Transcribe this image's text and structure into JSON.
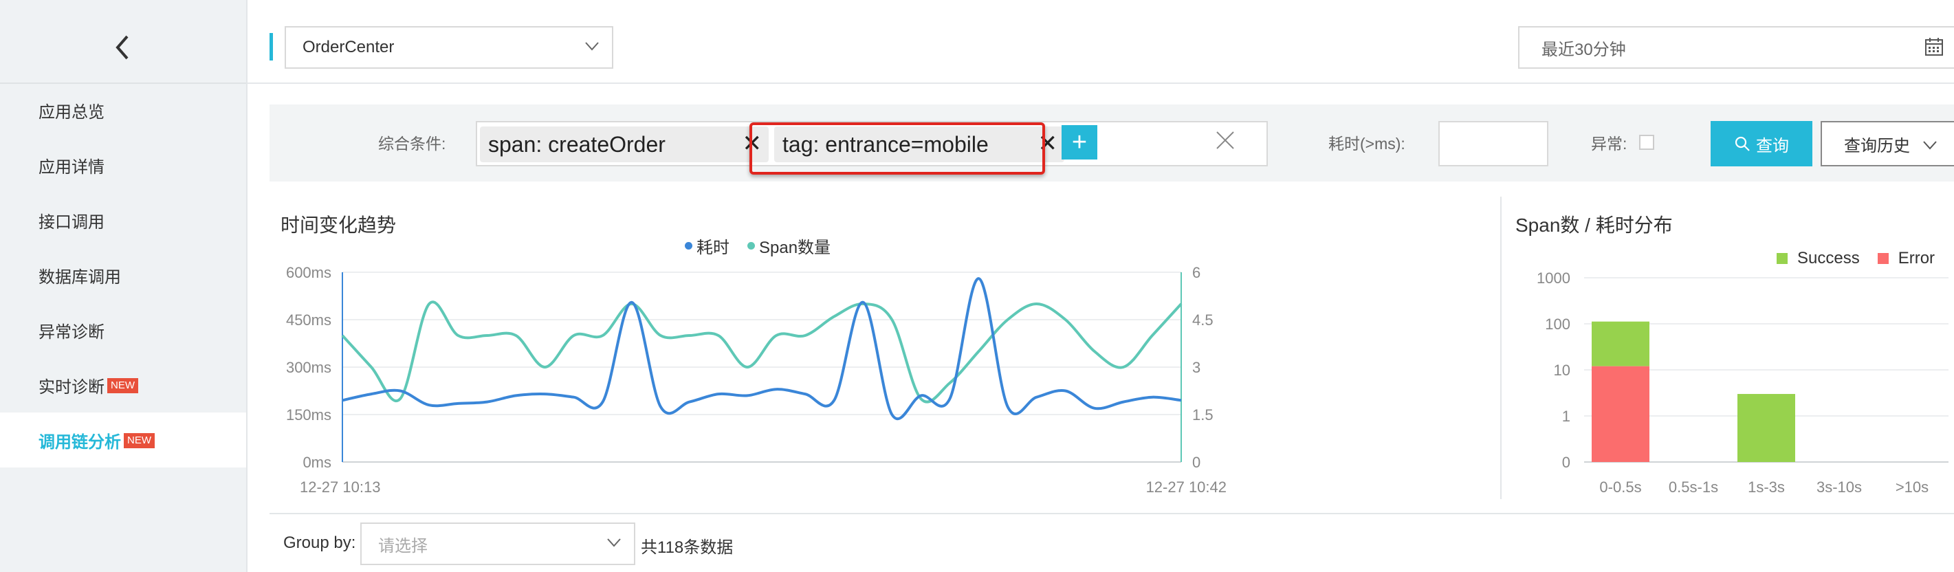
{
  "colors": {
    "accent": "#25b8d8",
    "duration_line": "#3a86d8",
    "span_line": "#5ec8b6",
    "success": "#97d24d",
    "error": "#fb6d6d",
    "new_badge": "#e8503a",
    "highlight": "#e0261f"
  },
  "sidebar": {
    "back_icon": "chevron-left-icon",
    "items": [
      {
        "label": "应用总览",
        "badge": ""
      },
      {
        "label": "应用详情",
        "badge": ""
      },
      {
        "label": "接口调用",
        "badge": ""
      },
      {
        "label": "数据库调用",
        "badge": ""
      },
      {
        "label": "异常诊断",
        "badge": ""
      },
      {
        "label": "实时诊断",
        "badge": "NEW"
      },
      {
        "label": "调用链分析",
        "badge": "NEW",
        "active": true
      }
    ]
  },
  "header": {
    "app_select": "OrderCenter",
    "time_range": "最近30分钟"
  },
  "filter": {
    "condition_label": "综合条件:",
    "tags": [
      {
        "label": "span:  createOrder"
      },
      {
        "label": "tag:  entrance=mobile"
      }
    ],
    "duration_label": "耗时(>ms):",
    "duration_value": "",
    "exception_label": "异常:",
    "exception_checked": false,
    "query_button": "查询",
    "history_button": "查询历史"
  },
  "trend_chart": {
    "title": "时间变化趋势",
    "legend": [
      "耗时",
      "Span数量"
    ],
    "y_left_ticks": [
      "600ms",
      "450ms",
      "300ms",
      "150ms",
      "0ms"
    ],
    "y_right_ticks": [
      "6",
      "4.5",
      "3",
      "1.5",
      "0"
    ],
    "x_start": "12-27 10:13",
    "x_end": "12-27 10:42"
  },
  "chart_data": [
    {
      "type": "line",
      "title": "时间变化趋势",
      "x": [
        "12-27 10:13",
        "",
        "",
        "",
        "",
        "",
        "",
        "",
        "",
        "",
        "",
        "",
        "",
        "",
        "",
        "",
        "",
        "",
        "",
        "",
        "",
        "",
        "",
        "",
        "",
        "",
        "",
        "",
        "",
        "12-27 10:42"
      ],
      "series": [
        {
          "name": "耗时",
          "axis": "left",
          "values": [
            195,
            215,
            225,
            180,
            185,
            190,
            210,
            215,
            205,
            190,
            505,
            175,
            190,
            215,
            210,
            230,
            215,
            195,
            505,
            150,
            210,
            200,
            580,
            175,
            205,
            225,
            170,
            190,
            205,
            195
          ]
        },
        {
          "name": "Span数量",
          "axis": "right",
          "values": [
            4.0,
            3.0,
            2.0,
            5.0,
            4.0,
            4.0,
            4.0,
            3.0,
            4.0,
            4.0,
            5.0,
            4.0,
            4.0,
            4.0,
            3.0,
            4.0,
            4.0,
            4.6,
            5.0,
            4.5,
            2.0,
            2.5,
            3.5,
            4.5,
            5.0,
            4.5,
            3.5,
            3.0,
            4.0,
            5.0
          ]
        }
      ],
      "ylim_left": [
        0,
        600
      ],
      "ylim_right": [
        0,
        6
      ]
    },
    {
      "type": "bar",
      "title": "Span数 / 耗时分布",
      "categories": [
        "0-0.5s",
        "0.5s-1s",
        "1s-3s",
        "3s-10s",
        ">10s"
      ],
      "series": [
        {
          "name": "Success",
          "values": [
            100,
            0,
            3,
            0,
            0
          ]
        },
        {
          "name": "Error",
          "values": [
            12,
            0,
            0,
            0,
            0
          ]
        }
      ],
      "y_scale": "log",
      "y_ticks": [
        "1000",
        "100",
        "10",
        "1",
        "0"
      ],
      "legend": [
        "Success",
        "Error"
      ]
    }
  ],
  "dist_chart": {
    "title": "Span数 / 耗时分布",
    "legend_success": "Success",
    "legend_error": "Error"
  },
  "group_by": {
    "label": "Group by:",
    "placeholder": "请选择",
    "count": "共118条数据"
  }
}
